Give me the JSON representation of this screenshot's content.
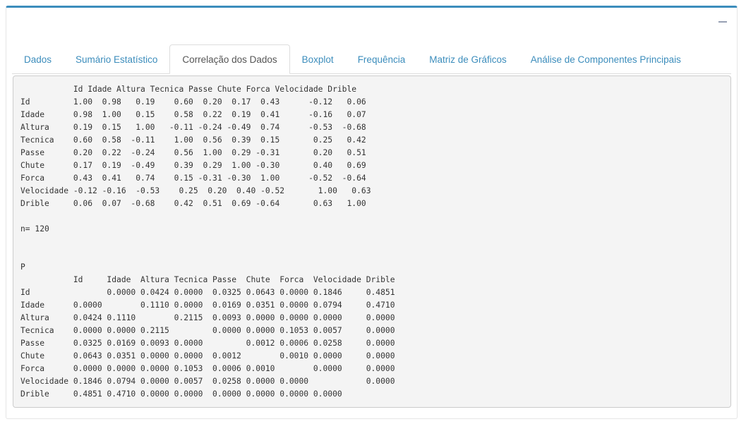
{
  "tabs": [
    {
      "label": "Dados",
      "active": false
    },
    {
      "label": "Sumário Estatístico",
      "active": false
    },
    {
      "label": "Correlação dos Dados",
      "active": true
    },
    {
      "label": "Boxplot",
      "active": false
    },
    {
      "label": "Frequência",
      "active": false
    },
    {
      "label": "Matriz de Gráficos",
      "active": false
    },
    {
      "label": "Análise de Componentes Principais",
      "active": false
    }
  ],
  "collapse_icon": "minus-icon",
  "colors": {
    "accent": "#3c8dbc",
    "output_bg": "#f4f4f4"
  },
  "correlation_output": "           Id Idade Altura Tecnica Passe Chute Forca Velocidade Drible\nId         1.00  0.98   0.19    0.60  0.20  0.17  0.43      -0.12   0.06\nIdade      0.98  1.00   0.15    0.58  0.22  0.19  0.41      -0.16   0.07\nAltura     0.19  0.15   1.00   -0.11 -0.24 -0.49  0.74      -0.53  -0.68\nTecnica    0.60  0.58  -0.11    1.00  0.56  0.39  0.15       0.25   0.42\nPasse      0.20  0.22  -0.24    0.56  1.00  0.29 -0.31       0.20   0.51\nChute      0.17  0.19  -0.49    0.39  0.29  1.00 -0.30       0.40   0.69\nForca      0.43  0.41   0.74    0.15 -0.31 -0.30  1.00      -0.52  -0.64\nVelocidade -0.12 -0.16  -0.53    0.25  0.20  0.40 -0.52       1.00   0.63\nDrible     0.06  0.07  -0.68    0.42  0.51  0.69 -0.64       0.63   1.00\n\nn= 120\n\n\nP\n           Id     Idade  Altura Tecnica Passe  Chute  Forca  Velocidade Drible\nId                0.0000 0.0424 0.0000  0.0325 0.0643 0.0000 0.1846     0.4851\nIdade      0.0000        0.1110 0.0000  0.0169 0.0351 0.0000 0.0794     0.4710\nAltura     0.0424 0.1110        0.2115  0.0093 0.0000 0.0000 0.0000     0.0000\nTecnica    0.0000 0.0000 0.2115         0.0000 0.0000 0.1053 0.0057     0.0000\nPasse      0.0325 0.0169 0.0093 0.0000         0.0012 0.0006 0.0258     0.0000\nChute      0.0643 0.0351 0.0000 0.0000  0.0012        0.0010 0.0000     0.0000\nForca      0.0000 0.0000 0.0000 0.1053  0.0006 0.0010        0.0000     0.0000\nVelocidade 0.1846 0.0794 0.0000 0.0057  0.0258 0.0000 0.0000            0.0000\nDrible     0.4851 0.4710 0.0000 0.0000  0.0000 0.0000 0.0000 0.0000"
}
